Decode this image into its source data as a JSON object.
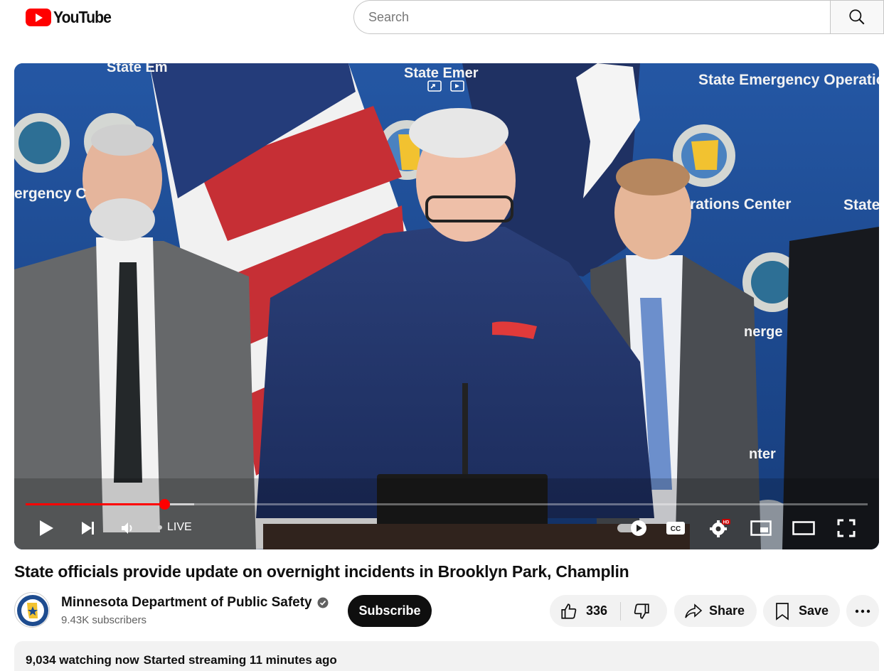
{
  "header": {
    "logo_text": "YouTube",
    "search_placeholder": "Search"
  },
  "player": {
    "live_label": "LIVE",
    "progress_fraction": 0.165,
    "buffer_fraction": 0.2,
    "backdrop_text": {
      "banner_top_left": "State Em",
      "banner_top_center": "State Emer",
      "banner_top_right": "State Emergency Operations",
      "left_wall": "ergency C",
      "center_wall": "rations Center",
      "right_wall": "State",
      "right_wall_lower": "nerge",
      "right_wall_bottom": "nter"
    },
    "colors": {
      "progress": "#ff0000",
      "backdrop": "#1b3f7e"
    }
  },
  "video": {
    "title": "State officials provide update on overnight incidents in Brooklyn Park, Champlin"
  },
  "channel": {
    "name": "Minnesota Department of Public Safety",
    "subscribers": "9.43K subscribers",
    "subscribe_label": "Subscribe"
  },
  "actions": {
    "like_count": "336",
    "share_label": "Share",
    "save_label": "Save"
  },
  "description": {
    "watching": "9,034 watching now",
    "started": "Started streaming 11 minutes ago"
  }
}
